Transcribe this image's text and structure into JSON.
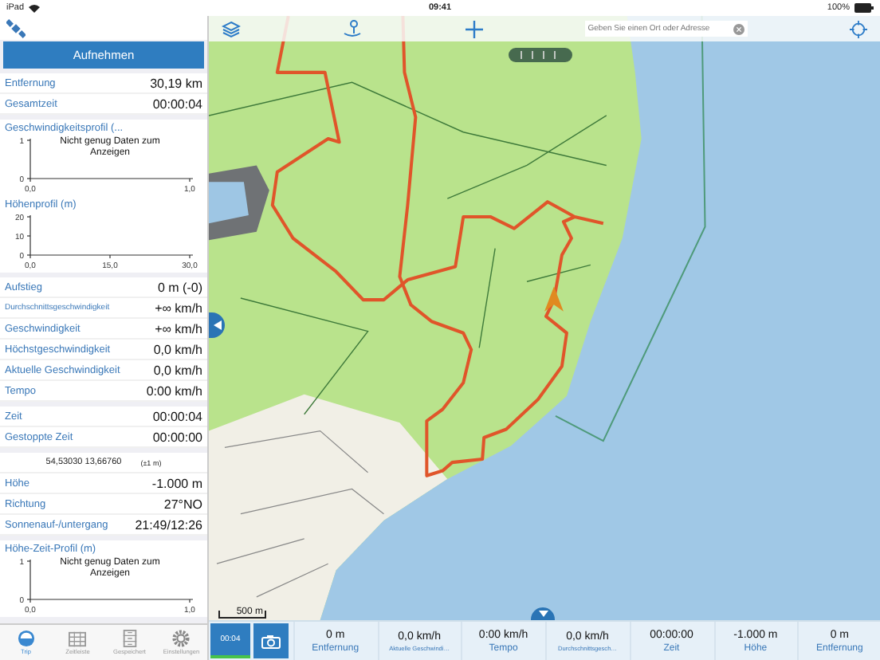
{
  "status_bar": {
    "device": "iPad",
    "time": "09:41",
    "battery": "100%"
  },
  "sidebar": {
    "record_button": "Aufnehmen",
    "groups": [
      {
        "items": [
          {
            "kind": "stat",
            "label": "Entfernung",
            "value": "30,19 km"
          },
          {
            "kind": "stat",
            "label": "Gesamtzeit",
            "value": "00:00:04"
          }
        ]
      },
      {
        "items": [
          {
            "kind": "chart",
            "message": "Nicht genug Daten zum Anzeigen",
            "chart_data": {
              "type": "line",
              "title": "Geschwindigkeitsprofil (...",
              "xlim": [
                0,
                1
              ],
              "ylim": [
                0,
                1
              ],
              "xticks": [
                {
                  "value": 0,
                  "label": "0,0"
                },
                {
                  "value": 1,
                  "label": "1,0"
                }
              ],
              "yticks": [
                0,
                1
              ]
            }
          },
          {
            "kind": "chart",
            "chart_data": {
              "type": "line",
              "title": "Höhenprofil (m)",
              "xlim": [
                0,
                30
              ],
              "ylim": [
                0,
                20
              ],
              "xticks": [
                {
                  "value": 0,
                  "label": "0,0"
                },
                {
                  "value": 15,
                  "label": "15,0"
                },
                {
                  "value": 30,
                  "label": "30,0"
                }
              ],
              "yticks": [
                0,
                10,
                20
              ]
            }
          }
        ]
      },
      {
        "items": [
          {
            "kind": "stat",
            "label": "Aufstieg",
            "value": "0 m (-0)"
          },
          {
            "kind": "stat_small",
            "label": "Durchschnittsgeschwindigkeit",
            "value": "+∞ km/h"
          },
          {
            "kind": "stat",
            "label": "Geschwindigkeit",
            "value": "+∞ km/h"
          },
          {
            "kind": "stat",
            "label": "Höchstgeschwindigkeit",
            "value": "0,0 km/h"
          },
          {
            "kind": "stat",
            "label": "Aktuelle Geschwindigkeit",
            "value": "0,0 km/h"
          },
          {
            "kind": "stat",
            "label": "Tempo",
            "value": "0:00 km/h"
          }
        ]
      },
      {
        "items": [
          {
            "kind": "stat",
            "label": "Zeit",
            "value": "00:00:04"
          },
          {
            "kind": "stat",
            "label": "Gestoppte Zeit",
            "value": "00:00:00"
          }
        ]
      },
      {
        "items": [
          {
            "kind": "coords",
            "label": "54,53030 13,66760",
            "value": "(±1 m)"
          },
          {
            "kind": "stat",
            "label": "Höhe",
            "value": "-1.000 m"
          },
          {
            "kind": "stat",
            "label": "Richtung",
            "value": "27°NO"
          },
          {
            "kind": "stat",
            "label": "Sonnenauf-/untergang",
            "value": "21:49/12:26"
          }
        ]
      },
      {
        "items": [
          {
            "kind": "chart",
            "message": "Nicht genug Daten zum Anzeigen",
            "chart_data": {
              "type": "line",
              "title": "Höhe-Zeit-Profil (m)",
              "xlim": [
                0,
                1
              ],
              "ylim": [
                0,
                1
              ],
              "xticks": [
                {
                  "value": 0,
                  "label": "0,0"
                },
                {
                  "value": 1,
                  "label": "1,0"
                }
              ],
              "yticks": [
                0,
                1
              ]
            }
          }
        ]
      }
    ]
  },
  "tab_bar": [
    {
      "label": "Trip",
      "selected": true
    },
    {
      "label": "Zeitleiste",
      "selected": false
    },
    {
      "label": "Gespeichert",
      "selected": false
    },
    {
      "label": "Einstellungen",
      "selected": false
    }
  ],
  "map": {
    "search": {
      "placeholder": "Geben Sie einen Ort oder Adresse"
    },
    "scale": "500 m"
  },
  "bottom_bar": {
    "timer": "00:04",
    "cells": [
      {
        "value": "0 m",
        "label": "Entfernung"
      },
      {
        "value": "0,0 km/h",
        "label": "Aktuelle Geschwindi…"
      },
      {
        "value": "0:00 km/h",
        "label": "Tempo"
      },
      {
        "value": "0,0 km/h",
        "label": "Durchschnittsgesch…"
      },
      {
        "value": "00:00:00",
        "label": "Zeit"
      },
      {
        "value": "-1.000 m",
        "label": "Höhe"
      },
      {
        "value": "0 m",
        "label": "Entfernung"
      }
    ]
  }
}
